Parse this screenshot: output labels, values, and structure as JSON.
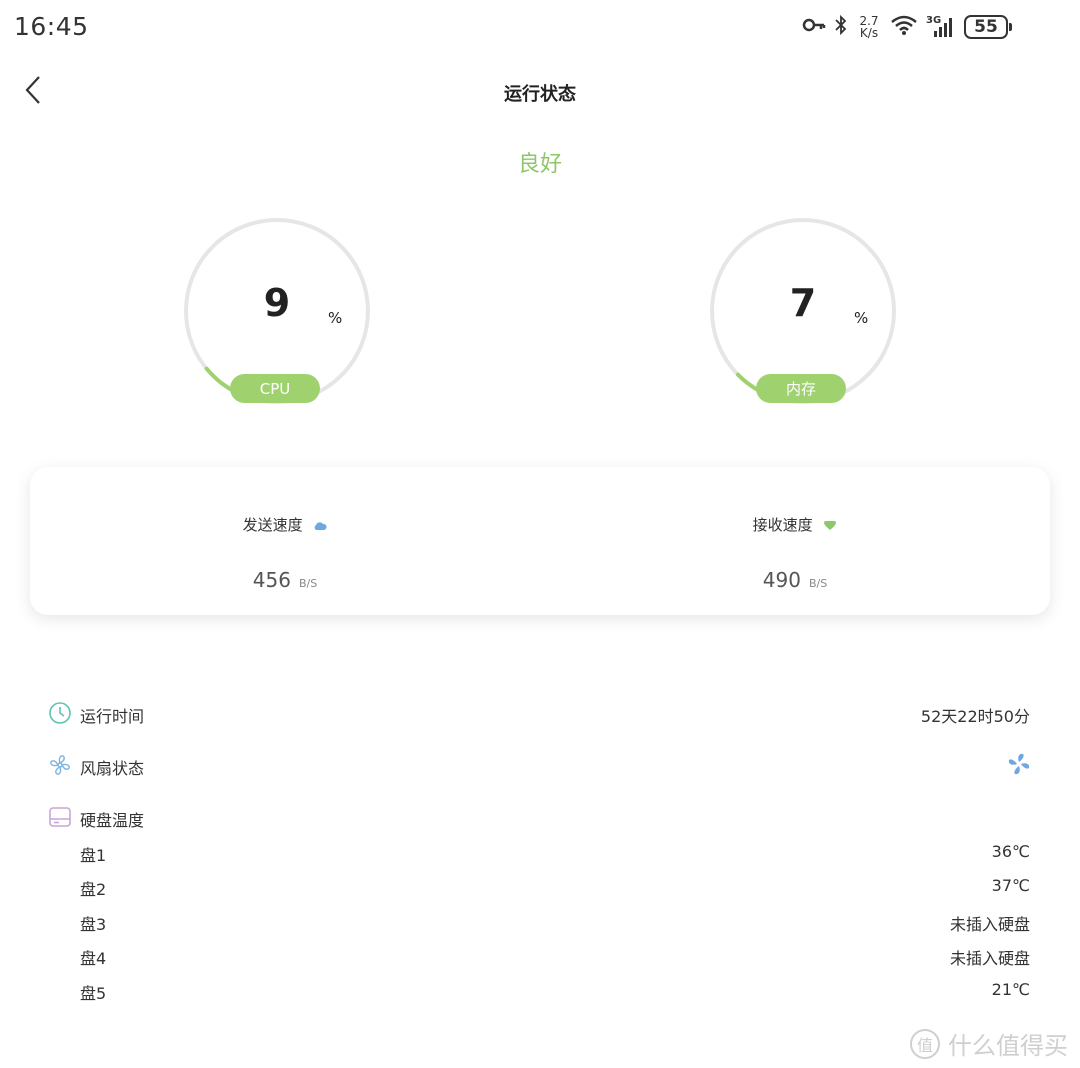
{
  "status_bar": {
    "time": "16:45",
    "net_speed_value": "2.7",
    "net_speed_unit": "K/s",
    "network_type": "3G",
    "battery": "55",
    "icons": [
      "key-icon",
      "bluetooth-icon",
      "wifi-icon",
      "signal-icon",
      "battery-icon"
    ]
  },
  "header": {
    "title": "运行状态",
    "back_icon": "chevron-left-icon"
  },
  "health": {
    "status": "良好",
    "color": "#8cc86a"
  },
  "gauges": {
    "cpu": {
      "value": "9",
      "unit": "%",
      "label": "CPU",
      "percent": 9
    },
    "memory": {
      "value": "7",
      "unit": "%",
      "label": "内存",
      "percent": 7
    }
  },
  "speed": {
    "send": {
      "label": "发送速度",
      "value": "456",
      "unit": "B/S",
      "icon": "upload-cloud-icon",
      "icon_color": "#6fa8e0"
    },
    "receive": {
      "label": "接收速度",
      "value": "490",
      "unit": "B/S",
      "icon": "download-heart-icon",
      "icon_color": "#8cc86a"
    }
  },
  "info": {
    "uptime": {
      "label": "运行时间",
      "value": "52天22时50分",
      "icon": "clock-icon"
    },
    "fan": {
      "label": "风扇状态",
      "icon": "fan-icon",
      "value_icon": "fan-running-icon"
    },
    "disk_temp": {
      "label": "硬盘温度",
      "icon": "hard-disk-icon"
    },
    "disks": [
      {
        "label": "盘1",
        "value": "36℃"
      },
      {
        "label": "盘2",
        "value": "37℃"
      },
      {
        "label": "盘3",
        "value": "未插入硬盘"
      },
      {
        "label": "盘4",
        "value": "未插入硬盘"
      },
      {
        "label": "盘5",
        "value": "21℃"
      }
    ]
  },
  "watermark": {
    "text": "什么值得买",
    "logo_char": "值"
  },
  "colors": {
    "accent_green": "#9fd26f",
    "gauge_track": "#e6e6e6",
    "cloud_blue": "#6fa8e0"
  }
}
